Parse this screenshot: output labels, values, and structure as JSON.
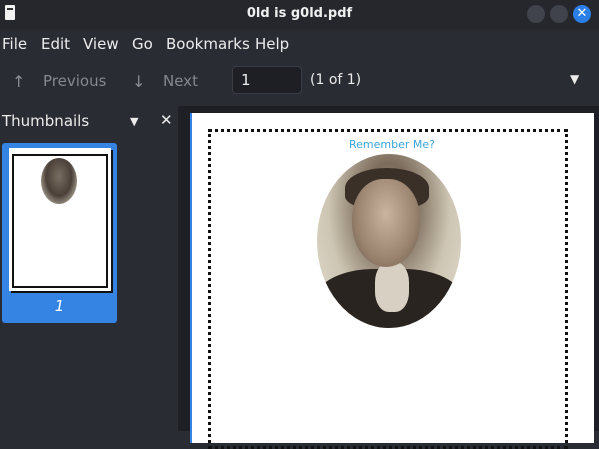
{
  "window": {
    "title": "0ld is g0ld.pdf"
  },
  "menu": {
    "items": [
      "File",
      "Edit",
      "View",
      "Go",
      "Bookmarks",
      "Help"
    ]
  },
  "toolbar": {
    "previous_label": "Previous",
    "next_label": "Next",
    "page_value": "1",
    "page_count": "(1 of 1)",
    "icons": {
      "previous": "arrow-up-icon",
      "next": "arrow-down-icon",
      "menu": "caret-down-icon"
    }
  },
  "sidebar": {
    "title": "Thumbnails",
    "thumbnails": [
      {
        "label": "1",
        "selected": true
      }
    ]
  },
  "document": {
    "heading": "Remember Me?"
  },
  "colors": {
    "accent": "#3584e4",
    "heading": "#3aa4d6",
    "background": "#2a2c33"
  }
}
